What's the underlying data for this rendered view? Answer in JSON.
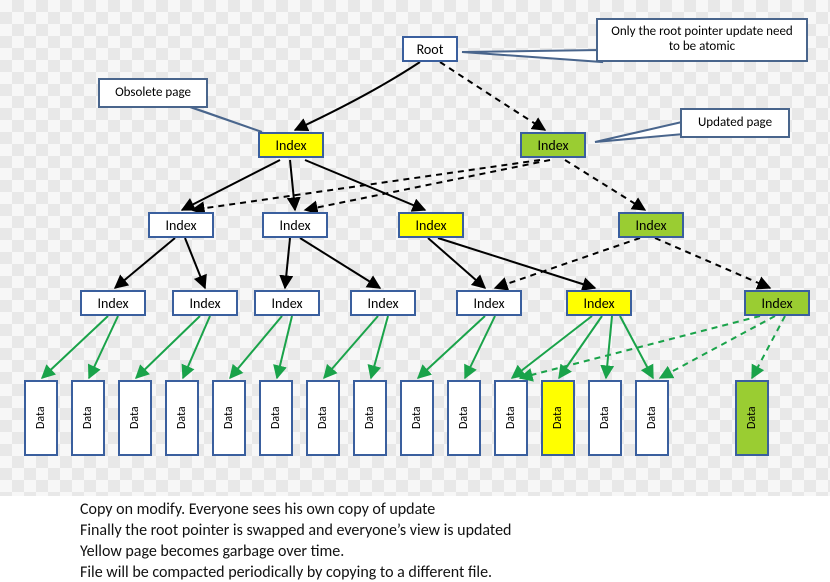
{
  "callouts": {
    "root_atomic": "Only the root pointer update need to be atomic",
    "obsolete": "Obsolete page",
    "updated": "Updated page"
  },
  "root": {
    "label": "Root"
  },
  "level1": {
    "left": {
      "label": "Index",
      "state": "yellow"
    },
    "right": {
      "label": "Index",
      "state": "green"
    }
  },
  "level2": [
    {
      "label": "Index",
      "state": "white"
    },
    {
      "label": "Index",
      "state": "white"
    },
    {
      "label": "Index",
      "state": "yellow"
    },
    {
      "label": "Index",
      "state": "green"
    }
  ],
  "level3": [
    {
      "label": "Index",
      "state": "white"
    },
    {
      "label": "Index",
      "state": "white"
    },
    {
      "label": "Index",
      "state": "white"
    },
    {
      "label": "Index",
      "state": "white"
    },
    {
      "label": "Index",
      "state": "white"
    },
    {
      "label": "Index",
      "state": "yellow"
    },
    {
      "label": "Index",
      "state": "green"
    }
  ],
  "data_row": [
    {
      "label": "Data",
      "state": "white"
    },
    {
      "label": "Data",
      "state": "white"
    },
    {
      "label": "Data",
      "state": "white"
    },
    {
      "label": "Data",
      "state": "white"
    },
    {
      "label": "Data",
      "state": "white"
    },
    {
      "label": "Data",
      "state": "white"
    },
    {
      "label": "Data",
      "state": "white"
    },
    {
      "label": "Data",
      "state": "white"
    },
    {
      "label": "Data",
      "state": "white"
    },
    {
      "label": "Data",
      "state": "white"
    },
    {
      "label": "Data",
      "state": "white"
    },
    {
      "label": "Data",
      "state": "yellow"
    },
    {
      "label": "Data",
      "state": "white"
    },
    {
      "label": "Data",
      "state": "white"
    },
    {
      "label": "Data",
      "state": "green"
    }
  ],
  "caption": {
    "l1": "Copy on modify.  Everyone sees his own copy of update",
    "l2": "Finally the root pointer is swapped and everyone’s view is updated",
    "l3": "Yellow page becomes garbage over time.",
    "l4": "File will be compacted periodically by copying to a different file."
  }
}
